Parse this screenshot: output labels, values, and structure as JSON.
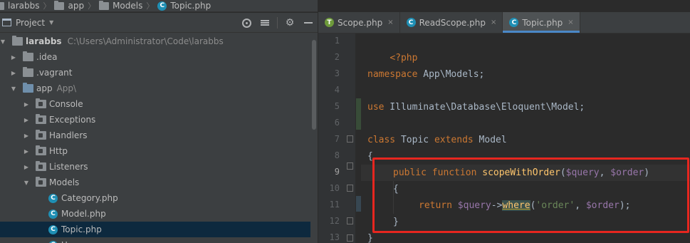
{
  "breadcrumb": {
    "items": [
      {
        "label": "larabbs",
        "icon": "folder-icon"
      },
      {
        "label": "app",
        "icon": "folder-icon"
      },
      {
        "label": "Models",
        "icon": "folder-icon"
      },
      {
        "label": "Topic.php",
        "icon": "php-class-icon"
      }
    ],
    "separator": "〉"
  },
  "project_panel": {
    "title": "Project",
    "tools": [
      "locate-icon",
      "collapse-all-icon",
      "settings-icon",
      "hide-icon"
    ],
    "tree": [
      {
        "label": "larabbs",
        "hint": "C:\\Users\\Administrator\\Code\\larabbs",
        "expanded": true,
        "type": "project"
      },
      {
        "label": ".idea",
        "expanded": false,
        "type": "folder"
      },
      {
        "label": ".vagrant",
        "expanded": false,
        "type": "folder"
      },
      {
        "label": "app",
        "hint": "App\\",
        "expanded": true,
        "type": "source-folder"
      },
      {
        "label": "Console",
        "expanded": false,
        "type": "package"
      },
      {
        "label": "Exceptions",
        "expanded": false,
        "type": "package"
      },
      {
        "label": "Handlers",
        "expanded": false,
        "type": "package"
      },
      {
        "label": "Http",
        "expanded": false,
        "type": "package"
      },
      {
        "label": "Listeners",
        "expanded": false,
        "type": "package"
      },
      {
        "label": "Models",
        "expanded": true,
        "type": "package"
      },
      {
        "label": "Category.php",
        "type": "class"
      },
      {
        "label": "Model.php",
        "type": "class"
      },
      {
        "label": "Topic.php",
        "type": "class",
        "selected": true
      },
      {
        "label": "U",
        "type": "class"
      }
    ]
  },
  "tabs": [
    {
      "label": "Scope.php",
      "icon": "php-trait-icon",
      "active": false
    },
    {
      "label": "ReadScope.php",
      "icon": "php-class-icon",
      "active": false
    },
    {
      "label": "Topic.php",
      "icon": "php-class-icon",
      "active": true
    }
  ],
  "tab_close": "×",
  "editor": {
    "line_numbers": [
      "1",
      "2",
      "3",
      "4",
      "5",
      "6",
      "7",
      "8",
      "9",
      "10",
      "11",
      "12",
      "13"
    ],
    "current_line": "9",
    "lines": {
      "l1": "<?php",
      "l3_kw": "namespace",
      "l3_rest": " App\\Models;",
      "l5_kw": "use",
      "l5_rest": " Illuminate\\Database\\Eloquent\\Model;",
      "l7_kw1": "class",
      "l7_name": " Topic ",
      "l7_kw2": "extends",
      "l7_rest": " Model",
      "l8": "{",
      "l9_kw1": "public",
      "l9_kw2": "function",
      "l9_fn": "scopeWithOrder",
      "l9_p1": "(",
      "l9_v1": "$query",
      "l9_c": ", ",
      "l9_v2": "$order",
      "l9_p2": ")",
      "l10": "{",
      "l11_kw": "return",
      "l11_v1": "$query",
      "l11_arrow": "->",
      "l11_m": "where",
      "l11_p1": "(",
      "l11_s": "'order'",
      "l11_c": ", ",
      "l11_v2": "$order",
      "l11_p2": ");",
      "l12": "}",
      "l13": "}"
    }
  },
  "annotation": {
    "color": "#e6261f"
  }
}
